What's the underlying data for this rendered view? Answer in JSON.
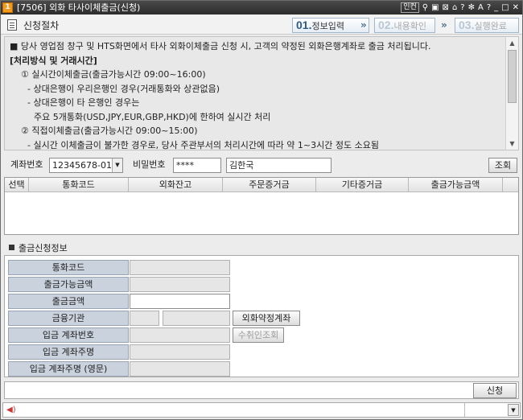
{
  "window": {
    "screen_no": "1",
    "title": "[7506] 외화 타사이체출금(신청)",
    "inkey_label": "인컨",
    "icons": [
      "pin-icon",
      "monitor-icon",
      "window-icon",
      "link-icon",
      "question-icon",
      "snowflake-icon",
      "font-size-icon",
      "help-icon",
      "minimize-icon",
      "maximize-icon",
      "close-icon"
    ]
  },
  "header": {
    "title": "신청절차",
    "steps": [
      {
        "num": "01.",
        "label": "정보입력"
      },
      {
        "num": "02.",
        "label": "내용확인"
      },
      {
        "num": "03.",
        "label": "실행완료"
      }
    ]
  },
  "info": {
    "lines": [
      "■ 당사 영업점 창구 및 HTS화면에서 타사 외화이체출금 신청 시, 고객의 약정된 외화은행계좌로 출금 처리됩니다.",
      "[처리방식 및 거래시간]",
      "① 실시간이체출금(출금가능시간 09:00~16:00)",
      "  - 상대은행이 우리은행인 경우(거래통화와 상관없음)",
      "  - 상대은행이 타 은행인 경우는",
      "    주요 5개통화(USD,JPY,EUR,GBP,HKD)에 한하여 실시간 처리",
      "② 직접이체출금(출금가능시간 09:00~15:00)",
      "  - 실시간 이체출금이 불가한 경우로, 당사 주관부서의 처리시간에 따라 약 1~3시간 정도 소요됨"
    ]
  },
  "account": {
    "account_label": "계좌번호",
    "account_value": "12345678-01",
    "password_label": "비밀번호",
    "password_value": "****",
    "owner_name": "김한국",
    "query_button": "조회"
  },
  "grid": {
    "columns": [
      "선택",
      "통화코드",
      "외화잔고",
      "주문증거금",
      "기타증거금",
      "출금가능금액"
    ]
  },
  "request": {
    "section_title": "출금신청정보",
    "fields": [
      {
        "label": "통화코드",
        "value": ""
      },
      {
        "label": "출금가능금액",
        "value": ""
      },
      {
        "label": "출금금액",
        "value": ""
      },
      {
        "label": "금융기관",
        "value": ""
      },
      {
        "label": "입금 계좌번호",
        "value": ""
      },
      {
        "label": "입금 계좌주명",
        "value": ""
      },
      {
        "label": "입금 계좌주명 (영문)",
        "value": ""
      }
    ],
    "fx_account_button": "외화약정계좌",
    "recipient_query_button": "수취인조회"
  },
  "footer": {
    "submit_button": "신청"
  }
}
